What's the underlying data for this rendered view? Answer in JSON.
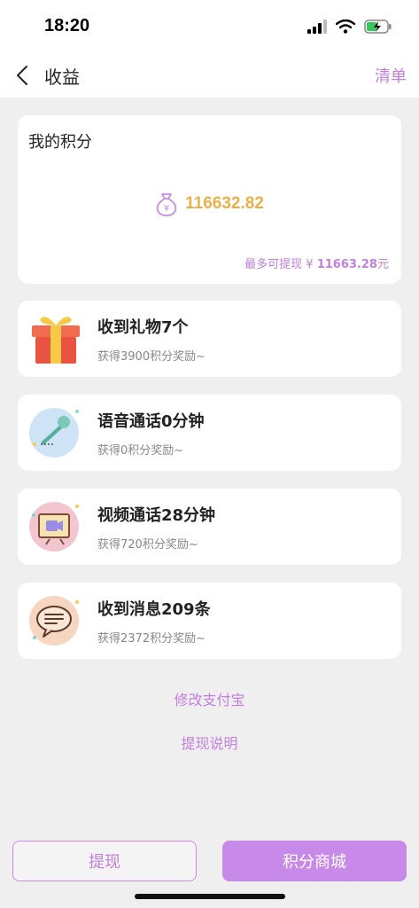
{
  "status": {
    "time": "18:20"
  },
  "nav": {
    "title": "收益",
    "action": "清单"
  },
  "points": {
    "label": "我的积分",
    "value": "116632.82",
    "withdraw_prefix": "最多可提现 ¥ ",
    "withdraw_amount": "11663.28",
    "withdraw_suffix": "元"
  },
  "stats": [
    {
      "icon": "gift-icon",
      "title": "收到礼物7个",
      "subtitle": "获得3900积分奖励~"
    },
    {
      "icon": "microphone-icon",
      "title": "语音通话0分钟",
      "subtitle": "获得0积分奖励~"
    },
    {
      "icon": "video-camera-icon",
      "title": "视频通话28分钟",
      "subtitle": "获得720积分奖励~"
    },
    {
      "icon": "chat-bubble-icon",
      "title": "收到消息209条",
      "subtitle": "获得2372积分奖励~"
    }
  ],
  "links": {
    "alipay": "修改支付宝",
    "explain": "提现说明"
  },
  "buttons": {
    "withdraw": "提现",
    "shop": "积分商城"
  },
  "colors": {
    "accent": "#c27fe0",
    "points": "#e8b149",
    "background": "#efefef"
  }
}
